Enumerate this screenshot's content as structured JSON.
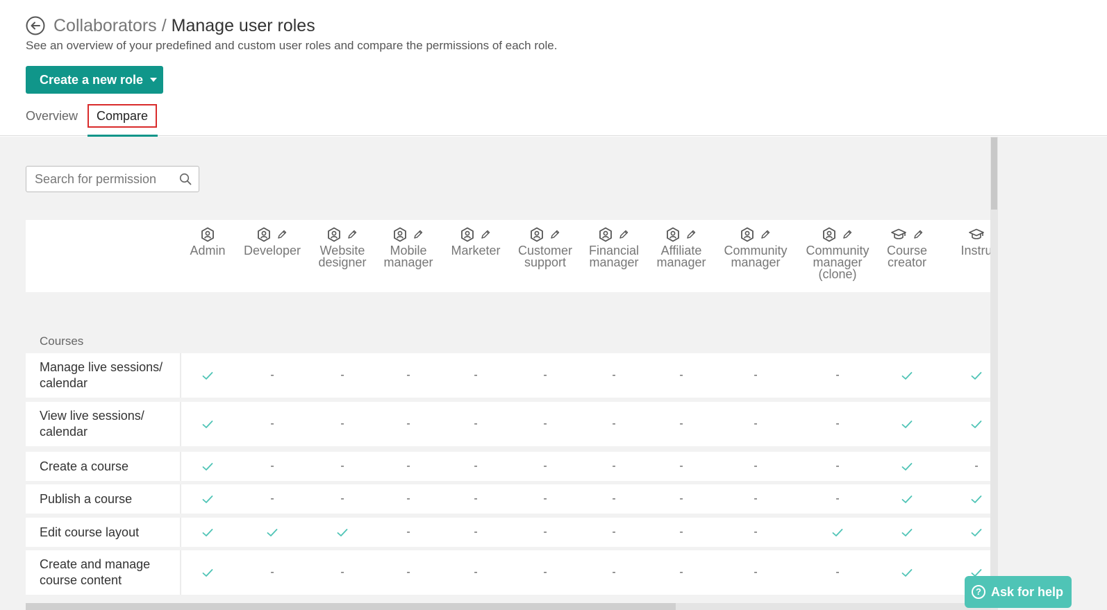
{
  "header": {
    "breadcrumb_parent": "Collaborators",
    "separator": "/",
    "title": "Manage user roles",
    "subtitle": "See an overview of your predefined and custom user roles and compare the permissions of each role.",
    "create_button_label": "Create a new role"
  },
  "tabs": [
    {
      "label": "Overview",
      "active": false
    },
    {
      "label": "Compare",
      "active": true
    }
  ],
  "search": {
    "placeholder": "Search for permission",
    "value": ""
  },
  "roles": [
    {
      "name": "Admin",
      "icon": "role-shield-icon",
      "editable": false
    },
    {
      "name": "Developer",
      "icon": "role-shield-icon",
      "editable": true
    },
    {
      "name": "Website designer",
      "icon": "role-shield-icon",
      "editable": true
    },
    {
      "name": "Mobile manager",
      "icon": "role-shield-icon",
      "editable": true
    },
    {
      "name": "Marketer",
      "icon": "role-shield-icon",
      "editable": true
    },
    {
      "name": "Customer support",
      "icon": "role-shield-icon",
      "editable": true
    },
    {
      "name": "Financial manager",
      "icon": "role-shield-icon",
      "editable": true
    },
    {
      "name": "Affiliate manager",
      "icon": "role-shield-icon",
      "editable": true
    },
    {
      "name": "Community manager",
      "icon": "role-shield-icon",
      "editable": true
    },
    {
      "name": "Community manager (clone)",
      "icon": "role-shield-icon",
      "editable": true
    },
    {
      "name": "Course creator",
      "icon": "graduation-cap-icon",
      "editable": true
    },
    {
      "name": "Instru",
      "icon": "graduation-cap-icon",
      "editable": false
    }
  ],
  "section": {
    "title": "Courses"
  },
  "permissions": [
    {
      "label": "Manage live sessions/ calendar",
      "values": [
        "✓",
        "-",
        "-",
        "-",
        "-",
        "-",
        "-",
        "-",
        "-",
        "-",
        "✓",
        "✓"
      ]
    },
    {
      "label": "View live sessions/ calendar",
      "values": [
        "✓",
        "-",
        "-",
        "-",
        "-",
        "-",
        "-",
        "-",
        "-",
        "-",
        "✓",
        "✓"
      ]
    },
    {
      "label": "Create a course",
      "values": [
        "✓",
        "-",
        "-",
        "-",
        "-",
        "-",
        "-",
        "-",
        "-",
        "-",
        "✓",
        "-"
      ]
    },
    {
      "label": "Publish a course",
      "values": [
        "✓",
        "-",
        "-",
        "-",
        "-",
        "-",
        "-",
        "-",
        "-",
        "-",
        "✓",
        "✓"
      ]
    },
    {
      "label": "Edit course layout",
      "values": [
        "✓",
        "✓",
        "✓",
        "-",
        "-",
        "-",
        "-",
        "-",
        "-",
        "✓",
        "✓",
        "✓"
      ]
    },
    {
      "label": "Create and manage course content",
      "values": [
        "✓",
        "-",
        "-",
        "-",
        "-",
        "-",
        "-",
        "-",
        "-",
        "-",
        "✓",
        "✓"
      ]
    }
  ],
  "help": {
    "label": "Ask for help",
    "icon": "question-circle-icon"
  },
  "colors": {
    "brand": "#10968a",
    "check": "#4fc4b6",
    "tab_highlight": "#d92b2b",
    "help_button": "#4fc4b6"
  }
}
